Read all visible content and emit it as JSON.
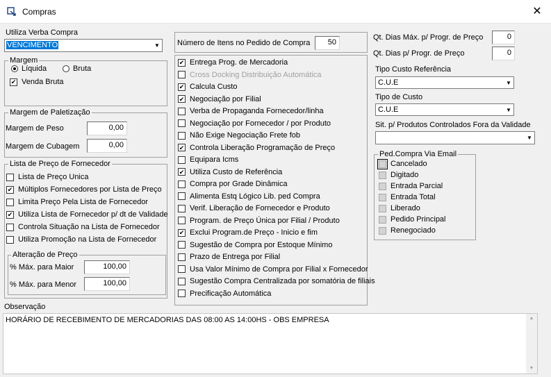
{
  "window": {
    "title": "Compras",
    "close_glyph": "✕"
  },
  "left": {
    "verba_label": "Utiliza Verba Compra",
    "verba_value": "VENCIMENTO",
    "margem": {
      "title": "Margem",
      "liquida": "Líquida",
      "bruta": "Bruta",
      "venda_bruta": "Venda Bruta"
    },
    "paletizacao": {
      "title": "Margem de Paletização",
      "peso_label": "Margem de Peso",
      "peso_value": "0,00",
      "cubagem_label": "Margem de Cubagem",
      "cubagem_value": "0,00"
    },
    "lista": {
      "title": "Lista de Preço de Fornecedor",
      "items": [
        {
          "label": "Lista de Preço Unica",
          "checked": false
        },
        {
          "label": "Múltiplos Fornecedores por Lista de Preço",
          "checked": true
        },
        {
          "label": "Limita Preço Pela Lista de Fornecedor",
          "checked": false
        },
        {
          "label": "Utiliza Lista de Fornecedor p/ dt de Validade",
          "checked": true
        },
        {
          "label": "Controla Situação na Lista de Fornecedor",
          "checked": false
        },
        {
          "label": "Utiliza Promoção na Lista de Fornecedor",
          "checked": false
        }
      ]
    },
    "alteracao": {
      "title": "Alteração de Preço",
      "maior_label": "% Máx. para Maior",
      "maior_value": "100,00",
      "menor_label": "% Máx. para Menor",
      "menor_value": "100,00"
    }
  },
  "middle": {
    "num_itens_label": "Número de Itens no Pedido de Compra",
    "num_itens_value": "50",
    "options": [
      {
        "label": "Entrega Prog. de Mercadoria",
        "checked": true,
        "disabled": false
      },
      {
        "label": "Cross Docking Distribuição Automática",
        "checked": false,
        "disabled": true
      },
      {
        "label": "Calcula Custo",
        "checked": true,
        "disabled": false
      },
      {
        "label": "Negociação por Filial",
        "checked": true,
        "disabled": false
      },
      {
        "label": "Verba de Propaganda Fornecedor/linha",
        "checked": false,
        "disabled": false
      },
      {
        "label": "Negociação por Fornecedor / por Produto",
        "checked": false,
        "disabled": false
      },
      {
        "label": "Não Exige Negociação Frete fob",
        "checked": false,
        "disabled": false
      },
      {
        "label": "Controla Liberação Programação de Preço",
        "checked": true,
        "disabled": false
      },
      {
        "label": "Equipara Icms",
        "checked": false,
        "disabled": false
      },
      {
        "label": "Utiliza Custo de Referência",
        "checked": true,
        "disabled": false
      },
      {
        "label": "Compra por Grade Dinâmica",
        "checked": false,
        "disabled": false
      },
      {
        "label": "Alimenta Estq Lógico Lib. ped Compra",
        "checked": false,
        "disabled": false
      },
      {
        "label": "Verif. Liberação de Fornecedor e Produto",
        "checked": false,
        "disabled": false
      },
      {
        "label": "Program. de Preço Única por Filial / Produto",
        "checked": false,
        "disabled": false
      },
      {
        "label": "Exclui Program.de Preço - Inicio e fim",
        "checked": true,
        "disabled": false
      },
      {
        "label": "Sugestão de Compra por Estoque Mínimo",
        "checked": false,
        "disabled": false
      },
      {
        "label": "Prazo de Entrega por Filial",
        "checked": false,
        "disabled": false
      },
      {
        "label": "Usa Valor Mínimo de Compra por Filial x Fornecedor",
        "checked": false,
        "disabled": false
      },
      {
        "label": "Sugestão Compra Centralizada por somatória de filiais",
        "checked": false,
        "disabled": false
      },
      {
        "label": "Precificação Automática",
        "checked": false,
        "disabled": false
      }
    ]
  },
  "right": {
    "dias_max_label": "Qt. Dias Máx. p/ Progr. de Preço",
    "dias_max_value": "0",
    "dias_label": "Qt. Dias p/ Progr. de Preço",
    "dias_value": "0",
    "tipo_custo_ref_label": "Tipo Custo Referência",
    "tipo_custo_ref_value": "C.U.E",
    "tipo_custo_label": "Tipo de Custo",
    "tipo_custo_value": "C.U.E",
    "sit_label": "Sit. p/ Produtos Controlados Fora da Validade",
    "sit_value": "",
    "email": {
      "title": "Ped.Compra Via Email",
      "items": [
        "Cancelado",
        "Digitado",
        "Entrada Parcial",
        "Entrada Total",
        "Liberado",
        "Pedido Principal",
        "Renegociado"
      ]
    }
  },
  "observacao": {
    "label": "Observação",
    "text": "HORÁRIO DE RECEBIMENTO DE MERCADORIAS DAS 08:00 AS 14:00HS - OBS EMPRESA"
  }
}
